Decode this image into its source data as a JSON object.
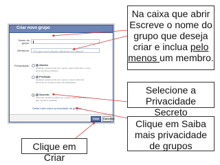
{
  "dialog": {
    "title": "Criar novo grupo",
    "name_label": "Nome do grupo:",
    "members_label": "Membros:",
    "members_placeholder": "Por que você deseja adicionar um grupo?",
    "privacy_label": "Privacidade:",
    "options": [
      {
        "label": "Aberto",
        "desc_1": "Qualquer pessoa pode ver o grupo, quem está nele e o que",
        "desc_2": "seus membros publicam.",
        "selected": false
      },
      {
        "label": "Fechado",
        "desc_1": "Qualquer pessoa pode ver o grupo e quem está nele.",
        "desc_2": "Somente os membros veem as publicações.",
        "selected": false
      },
      {
        "label": "Secreto",
        "desc_1": "Somente membros podem ver o grupo, quem está nele e o",
        "desc_2": "que membros publicam.",
        "selected": true
      }
    ],
    "privacy_link": "Saiba mais sobre privacidade de grupos",
    "create_button": "Criar",
    "cancel_button": "Cancelar"
  },
  "callouts": {
    "top": {
      "l1": "Na caixa que abrir",
      "l2": "Escreve o nome do",
      "l3": "grupo que deseja",
      "l4a": "criar e inclua ",
      "l4b": "pelo",
      "l5a": "menos ",
      "l5b": "um membro."
    },
    "privacy": {
      "l1": "Selecione a",
      "l2": "Privacidade Secreto"
    },
    "link": {
      "l1": "Clique em Saiba",
      "l2": "mais privacidade",
      "l3": "de grupos"
    },
    "create": {
      "l1": "Clique em Criar"
    }
  },
  "colors": {
    "dialog_header": "#6d84b4",
    "dialog_border": "#3b5998",
    "arrow": "#d93a3a"
  }
}
